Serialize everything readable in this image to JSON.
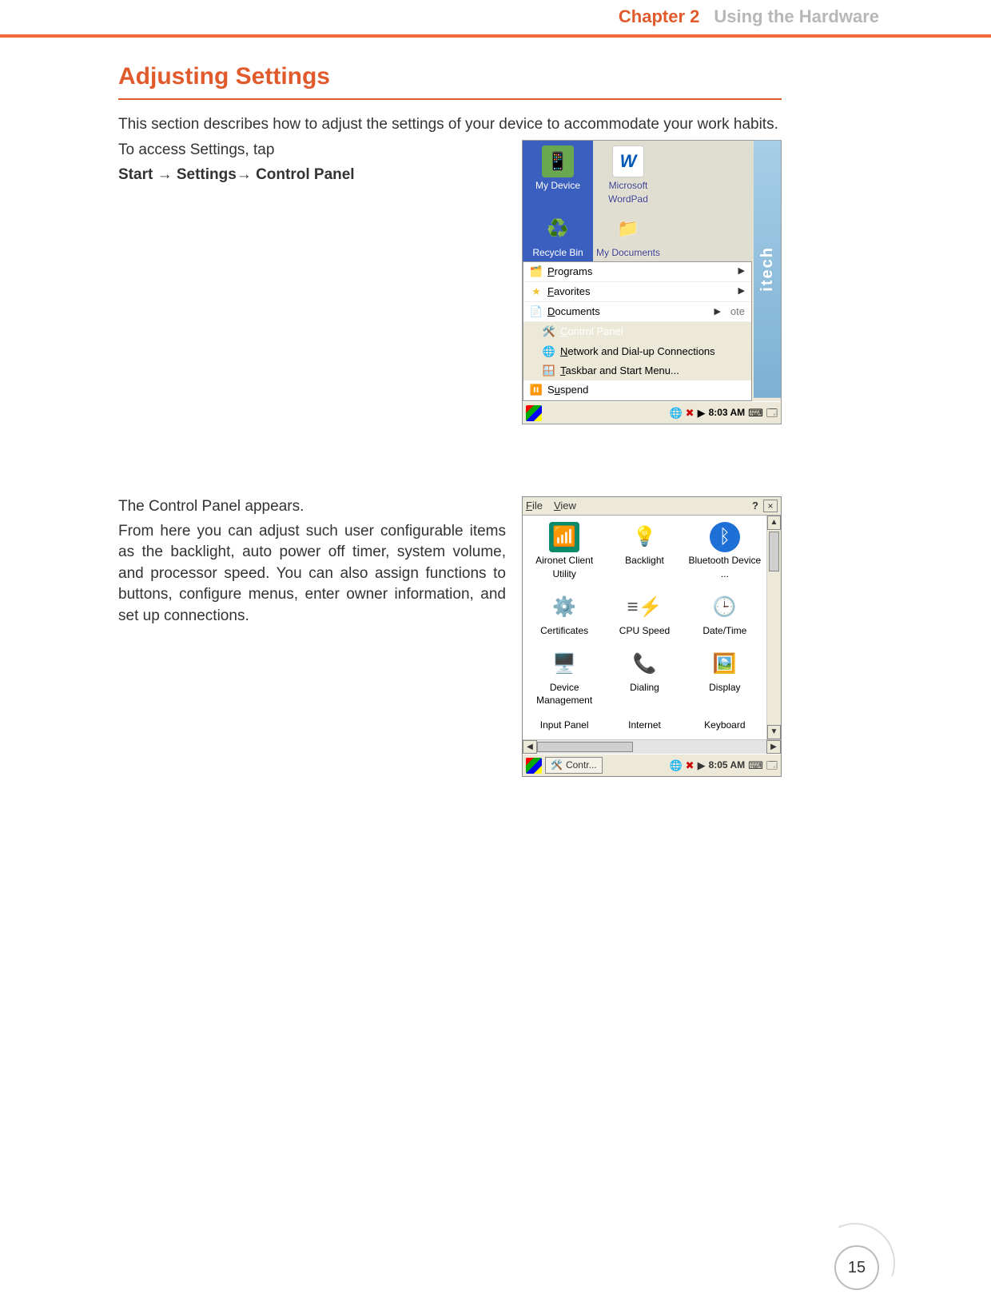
{
  "header": {
    "chapter_label": "Chapter 2",
    "chapter_title": "Using the Hardware"
  },
  "section": {
    "title": "Adjusting Settings",
    "intro": "This section describes how to adjust the settings of your device to accommodate your work habits.",
    "access_line": "To access Settings, tap",
    "access_path": "Start → Settings→ Control Panel",
    "cp_appears": "The Control Panel appears.",
    "cp_desc": "From here you can adjust such user configurable items as the backlight, auto power off timer, system volume, and processor speed. You can also assign functions to buttons, configure menus, enter owner information, and set up connections."
  },
  "screenshot1": {
    "brand": "itech",
    "desktop": {
      "my_device": "My Device",
      "wordpad": "Microsoft WordPad",
      "recycle": "Recycle Bin",
      "my_docs": "My Documents"
    },
    "menu": {
      "programs": "Programs",
      "favorites": "Favorites",
      "documents": "Documents",
      "note_frag": "ote",
      "control_panel": "Control Panel",
      "network": "Network and Dial-up Connections",
      "taskbar": "Taskbar and Start Menu...",
      "suspend": "Suspend"
    },
    "taskbar": {
      "time": "8:03 AM"
    }
  },
  "screenshot2": {
    "menubar": {
      "file": "File",
      "view": "View"
    },
    "items": {
      "aironet": "Aironet Client Utility",
      "backlight": "Backlight",
      "bluetooth": "Bluetooth Device ...",
      "certificates": "Certificates",
      "cpu": "CPU Speed",
      "datetime": "Date/Time",
      "devmgmt": "Device Management",
      "dialing": "Dialing",
      "display": "Display",
      "inputpanel": "Input Panel",
      "internet": "Internet",
      "keyboard": "Keyboard"
    },
    "taskbar": {
      "app": "Contr...",
      "time": "8:05 AM"
    }
  },
  "page_number": "15"
}
